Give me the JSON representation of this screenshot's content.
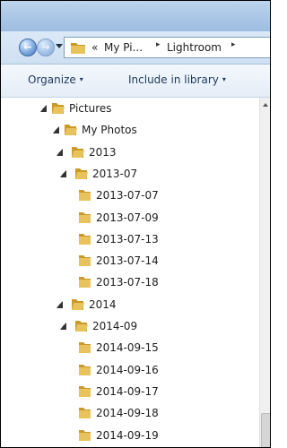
{
  "address": {
    "crumbs": [
      "My Pi...",
      "Lightroom"
    ],
    "chevron": "▸",
    "overflow": "«"
  },
  "toolbar": {
    "organize": "Organize",
    "include": "Include in library",
    "dropdown": "▾"
  },
  "tree": {
    "items": [
      {
        "label": "Pictures",
        "level": 0,
        "expanded": true
      },
      {
        "label": "My Photos",
        "level": 1,
        "expanded": true
      },
      {
        "label": "2013",
        "level": 2,
        "expanded": true
      },
      {
        "label": "2013-07",
        "level": 3,
        "expanded": true
      },
      {
        "label": "2013-07-07",
        "level": 4,
        "expanded": false
      },
      {
        "label": "2013-07-09",
        "level": 4,
        "expanded": false
      },
      {
        "label": "2013-07-13",
        "level": 4,
        "expanded": false
      },
      {
        "label": "2013-07-14",
        "level": 4,
        "expanded": false
      },
      {
        "label": "2013-07-18",
        "level": 4,
        "expanded": false
      },
      {
        "label": "2014",
        "level": 2,
        "expanded": true
      },
      {
        "label": "2014-09",
        "level": 3,
        "expanded": true
      },
      {
        "label": "2014-09-15",
        "level": 4,
        "expanded": false
      },
      {
        "label": "2014-09-16",
        "level": 4,
        "expanded": false
      },
      {
        "label": "2014-09-17",
        "level": 4,
        "expanded": false
      },
      {
        "label": "2014-09-18",
        "level": 4,
        "expanded": false
      },
      {
        "label": "2014-09-19",
        "level": 4,
        "expanded": false
      }
    ]
  },
  "icons": {
    "back": "arrow-left-icon",
    "forward": "arrow-right-icon",
    "folder": "folder-icon",
    "expand": "triangle-expanded-icon"
  },
  "colors": {
    "folder": "#e8c25a",
    "folder_dark": "#c99a2a",
    "nav_blue": "#3f73b8",
    "toolbar_text": "#1e395b"
  }
}
